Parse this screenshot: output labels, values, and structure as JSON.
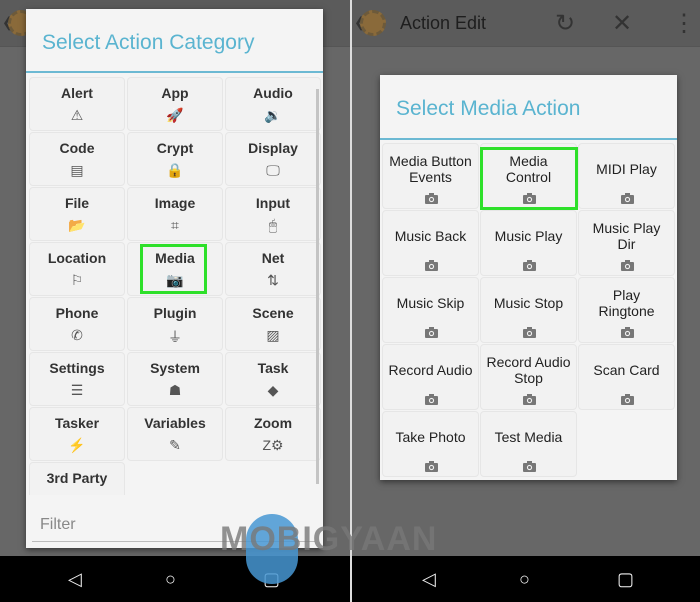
{
  "left": {
    "dialog_title": "Select Action Category",
    "categories": [
      {
        "label": "Alert",
        "icon": "⚠"
      },
      {
        "label": "App",
        "icon": "🚀"
      },
      {
        "label": "Audio",
        "icon": "🔉"
      },
      {
        "label": "Code",
        "icon": "▤"
      },
      {
        "label": "Crypt",
        "icon": "🔒"
      },
      {
        "label": "Display",
        "icon": "🖵"
      },
      {
        "label": "File",
        "icon": "📂"
      },
      {
        "label": "Image",
        "icon": "⌗"
      },
      {
        "label": "Input",
        "icon": "🖱"
      },
      {
        "label": "Location",
        "icon": "⚐"
      },
      {
        "label": "Media",
        "icon": "📷"
      },
      {
        "label": "Net",
        "icon": "⇅"
      },
      {
        "label": "Phone",
        "icon": "✆"
      },
      {
        "label": "Plugin",
        "icon": "⏚"
      },
      {
        "label": "Scene",
        "icon": "▨"
      },
      {
        "label": "Settings",
        "icon": "☰"
      },
      {
        "label": "System",
        "icon": "☗"
      },
      {
        "label": "Task",
        "icon": "◆"
      },
      {
        "label": "Tasker",
        "icon": "⚡"
      },
      {
        "label": "Variables",
        "icon": "✎"
      },
      {
        "label": "Zoom",
        "icon": "Z⚙"
      },
      {
        "label": "3rd Party",
        "icon": "☁"
      }
    ],
    "selected": "Media",
    "filter_placeholder": "Filter"
  },
  "right": {
    "app_title": "Action Edit",
    "dialog_title": "Select Media Action",
    "actions": [
      "Media Button Events",
      "Media Control",
      "MIDI Play",
      "Music Back",
      "Music Play",
      "Music Play Dir",
      "Music Skip",
      "Music Stop",
      "Play Ringtone",
      "Record Audio",
      "Record Audio Stop",
      "Scan Card",
      "Take Photo",
      "Test Media"
    ],
    "selected": "Media Control"
  },
  "watermark": "MOBIGYAAN",
  "colors": {
    "accent": "#5ab4d0",
    "highlight": "#2ee02a"
  }
}
